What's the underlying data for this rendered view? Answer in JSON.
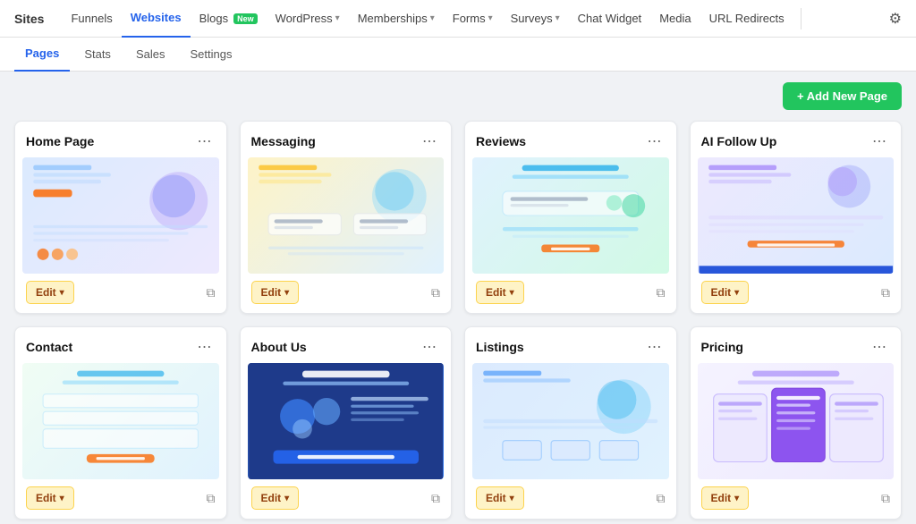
{
  "brand": "Sites",
  "nav": {
    "items": [
      {
        "label": "Funnels",
        "active": false,
        "hasDropdown": false
      },
      {
        "label": "Websites",
        "active": true,
        "hasDropdown": false
      },
      {
        "label": "Blogs",
        "active": false,
        "hasDropdown": false,
        "badge": "New"
      },
      {
        "label": "WordPress",
        "active": false,
        "hasDropdown": true
      },
      {
        "label": "Memberships",
        "active": false,
        "hasDropdown": true
      },
      {
        "label": "Forms",
        "active": false,
        "hasDropdown": true
      },
      {
        "label": "Surveys",
        "active": false,
        "hasDropdown": true
      },
      {
        "label": "Chat Widget",
        "active": false,
        "hasDropdown": false
      },
      {
        "label": "Media",
        "active": false,
        "hasDropdown": false
      },
      {
        "label": "URL Redirects",
        "active": false,
        "hasDropdown": false
      }
    ]
  },
  "subnav": {
    "items": [
      {
        "label": "Pages",
        "active": true
      },
      {
        "label": "Stats",
        "active": false
      },
      {
        "label": "Sales",
        "active": false
      },
      {
        "label": "Settings",
        "active": false
      }
    ]
  },
  "toolbar": {
    "add_button": "+ Add New Page"
  },
  "cards": [
    {
      "title": "Home Page",
      "thumb_class": "thumb-homepage",
      "edit_label": "Edit",
      "id": "home-page"
    },
    {
      "title": "Messaging",
      "thumb_class": "thumb-messaging",
      "edit_label": "Edit",
      "id": "messaging"
    },
    {
      "title": "Reviews",
      "thumb_class": "thumb-reviews",
      "edit_label": "Edit",
      "id": "reviews"
    },
    {
      "title": "AI Follow Up",
      "thumb_class": "thumb-aifollow",
      "edit_label": "Edit",
      "id": "ai-follow-up"
    },
    {
      "title": "Contact",
      "thumb_class": "thumb-contact",
      "edit_label": "Edit",
      "id": "contact"
    },
    {
      "title": "About Us",
      "thumb_class": "thumb-aboutus",
      "edit_label": "Edit",
      "id": "about-us"
    },
    {
      "title": "Listings",
      "thumb_class": "thumb-listings",
      "edit_label": "Edit",
      "id": "listings"
    },
    {
      "title": "Pricing",
      "thumb_class": "thumb-pricing",
      "edit_label": "Edit",
      "id": "pricing"
    }
  ]
}
